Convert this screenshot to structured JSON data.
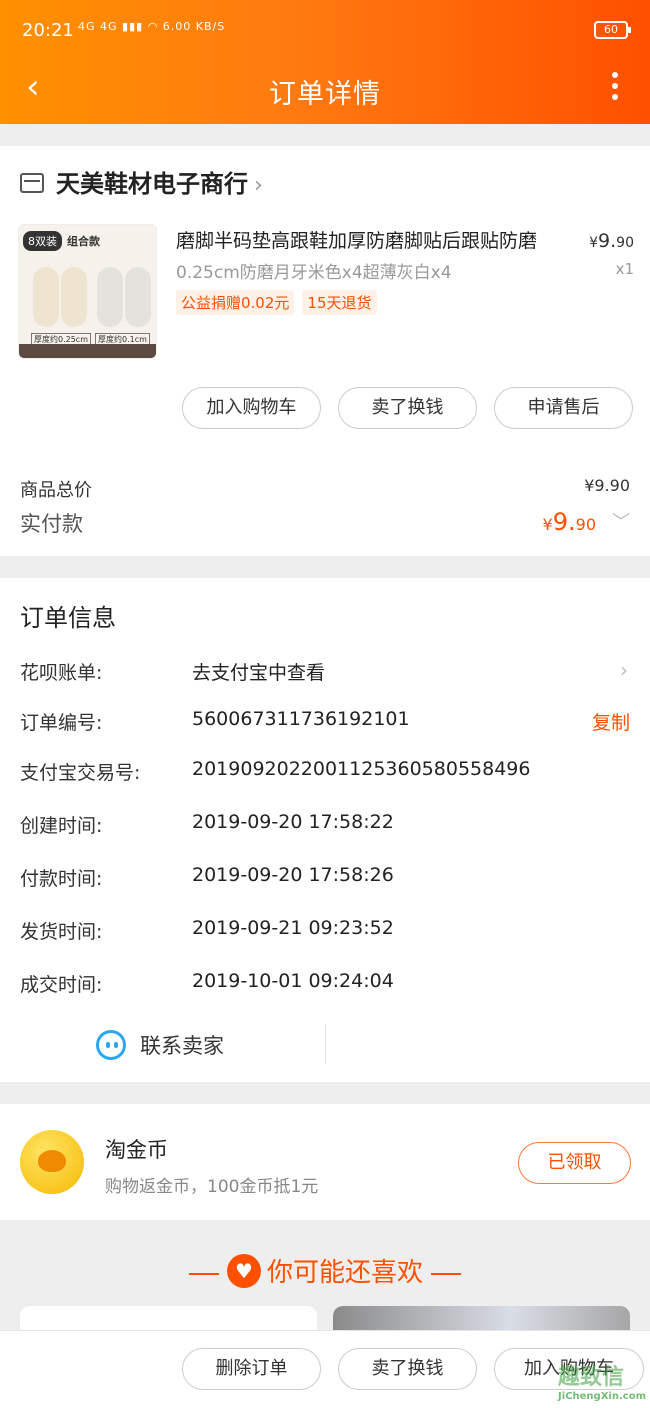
{
  "status_bar": {
    "time": "20:21",
    "signal": "4G 4G",
    "speed": "6.00 KB/S",
    "battery": "60"
  },
  "nav": {
    "title": "订单详情",
    "back_icon": "chevron-left-icon",
    "more_icon": "more-vertical-icon"
  },
  "shop": {
    "name": "天美鞋材电子商行",
    "product": {
      "title": "磨脚半码垫高跟鞋加厚防磨脚贴后跟贴防磨",
      "sku": "0.25cm防磨月牙米色x4超薄灰白x4",
      "price_symbol": "¥",
      "price_int": "9.",
      "price_dec": "90",
      "qty": "x1",
      "badges": [
        "公益捐赠0.02元",
        "15天退货"
      ],
      "image_tag": "8双装",
      "image_tag2": "组合款",
      "image_label1": "厚度约0.25cm",
      "image_label2": "厚度约0.1cm"
    },
    "actions": [
      "加入购物车",
      "卖了换钱",
      "申请售后"
    ],
    "total_label": "商品总价",
    "total_value": "¥9.90",
    "paid_label": "实付款",
    "paid_symbol": "¥",
    "paid_int": "9.",
    "paid_dec": "90"
  },
  "order_info": {
    "title": "订单信息",
    "rows": [
      {
        "key": "花呗账单:",
        "value": "去支付宝中查看"
      },
      {
        "key": "订单编号:",
        "value": "560067311736192101",
        "action": "复制"
      },
      {
        "key": "支付宝交易号:",
        "value": "2019092022001125360580558496"
      },
      {
        "key": "创建时间:",
        "value": "2019-09-20 17:58:22"
      },
      {
        "key": "付款时间:",
        "value": "2019-09-20 17:58:26"
      },
      {
        "key": "发货时间:",
        "value": "2019-09-21 09:23:52"
      },
      {
        "key": "成交时间:",
        "value": "2019-10-01 09:24:04"
      }
    ],
    "contact_label": "联系卖家"
  },
  "coin": {
    "title": "淘金币",
    "subtitle": "购物返金币，100金币抵1元",
    "button": "已领取"
  },
  "recommend": {
    "title": "你可能还喜欢"
  },
  "bottom_bar": {
    "buttons": [
      "删除订单",
      "卖了换钱",
      "加入购物车"
    ]
  },
  "watermark": {
    "text": "趣致信",
    "url": "JiChengXin.com"
  },
  "colors": {
    "accent": "#ff5000",
    "header_start": "#ff9000",
    "contact_icon": "#29a8f0"
  }
}
